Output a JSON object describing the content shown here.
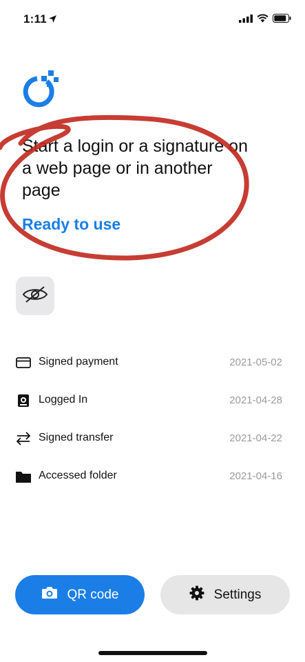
{
  "status_bar": {
    "time": "1:11",
    "icons": [
      "location-arrow-icon",
      "signal-icon",
      "wifi-icon",
      "battery-icon"
    ]
  },
  "logo": {
    "icon": "app-logo-icon",
    "color": "#1a7ee6"
  },
  "headline": "Start a login or a signature on a web page or in another page",
  "status_text": "Ready to use",
  "visibility_toggle": {
    "icon": "eye-slash-icon"
  },
  "activity": [
    {
      "icon": "card-icon",
      "label": "Signed payment",
      "date": "2021-05-02"
    },
    {
      "icon": "id-badge-icon",
      "label": "Logged In",
      "date": "2021-04-28"
    },
    {
      "icon": "transfer-arrows-icon",
      "label": "Signed transfer",
      "date": "2021-04-22"
    },
    {
      "icon": "folder-icon",
      "label": "Accessed folder",
      "date": "2021-04-16"
    }
  ],
  "buttons": {
    "qr": {
      "label": "QR code",
      "icon": "camera-icon"
    },
    "settings": {
      "label": "Settings",
      "icon": "gear-icon"
    }
  },
  "colors": {
    "accent": "#1a7ee6",
    "annotation": "#c0281d",
    "secondary_text": "#9a9a9a"
  }
}
